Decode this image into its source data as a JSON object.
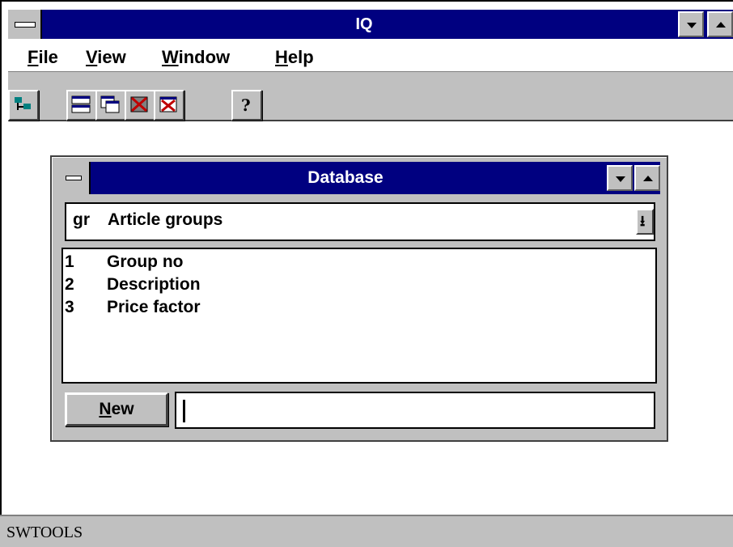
{
  "app": {
    "title": "IQ"
  },
  "menu": {
    "file": "File",
    "view": "View",
    "window": "Window",
    "help": "Help"
  },
  "toolbar": {
    "icons": [
      "network-icon",
      "tile-icon",
      "cascade-icon",
      "delete-icon",
      "close-icon",
      "help-icon"
    ]
  },
  "database_window": {
    "title": "Database",
    "selected_table_code": "gr",
    "selected_table_name": "Article groups",
    "fields": [
      {
        "no": "1",
        "name": "Group no"
      },
      {
        "no": "2",
        "name": "Description"
      },
      {
        "no": "3",
        "name": "Price factor"
      }
    ],
    "new_button": "New",
    "new_input_value": ""
  },
  "status": {
    "text": "SWTOOLS"
  },
  "colors": {
    "titlebar": "#000080",
    "face": "#c0c0c0"
  }
}
